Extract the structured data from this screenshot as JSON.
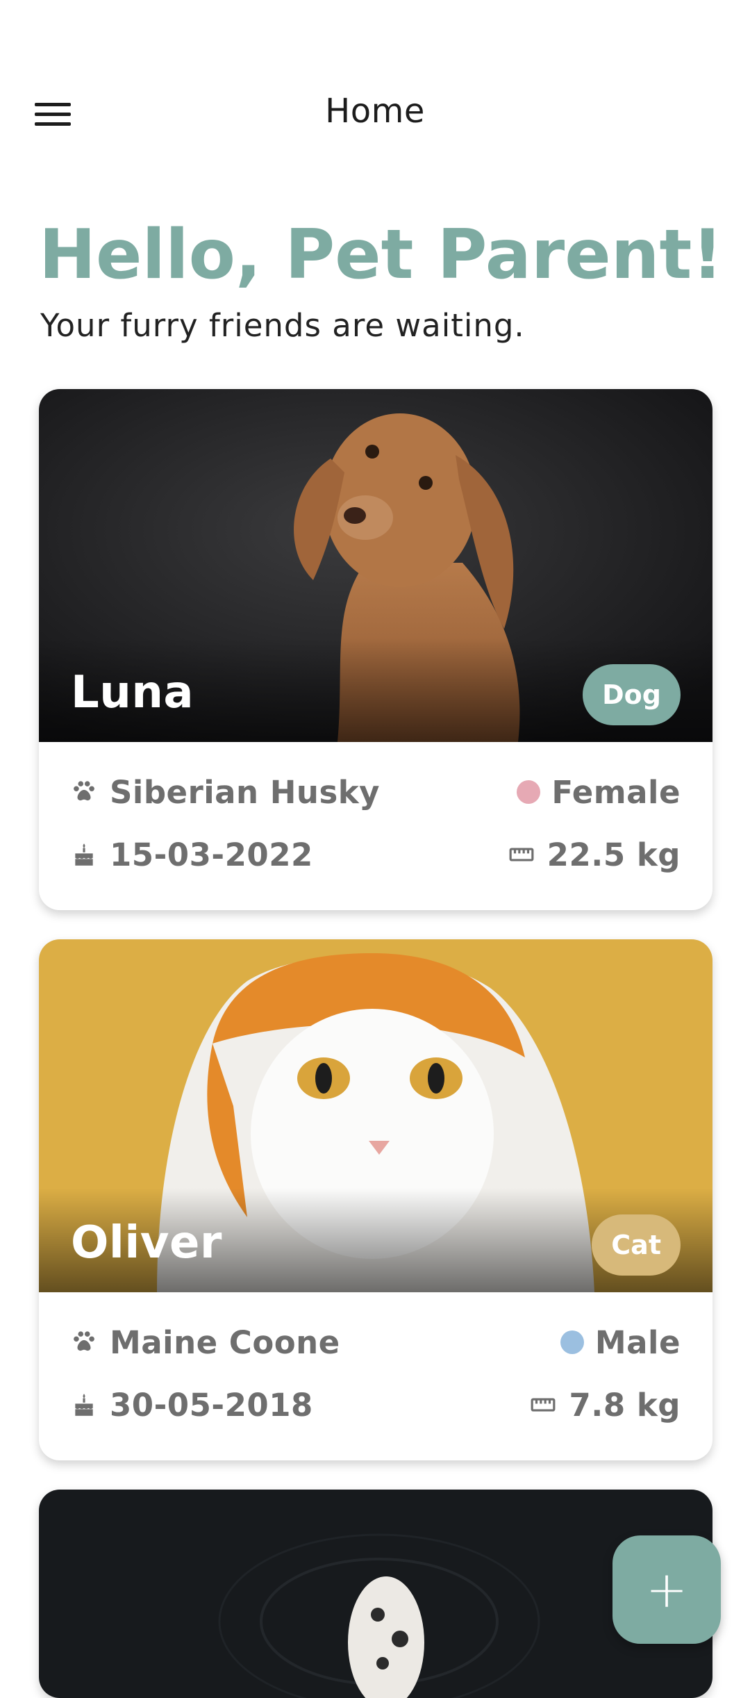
{
  "appbar": {
    "title": "Home",
    "menu_icon": "menu-icon"
  },
  "greeting": {
    "title": "Hello, Pet Parent!",
    "subtitle": "Your furry friends are waiting."
  },
  "colors": {
    "accent": "#7eaba2",
    "dog_badge": "#7eaba2",
    "cat_badge": "#d7b97a",
    "female_dot": "#e6a9b4",
    "male_dot": "#9bbfe0"
  },
  "pets": [
    {
      "name": "Luna",
      "type": "Dog",
      "breed": "Siberian Husky",
      "gender": "Female",
      "birthdate": "15-03-2022",
      "weight": "22.5 kg"
    },
    {
      "name": "Oliver",
      "type": "Cat",
      "breed": "Maine Coone",
      "gender": "Male",
      "birthdate": "30-05-2018",
      "weight": "7.8 kg"
    }
  ],
  "icons": {
    "breed": "paw-icon",
    "birthday": "cake-icon",
    "weight": "ruler-icon",
    "fab": "plus-icon"
  },
  "fab": {
    "label": "+"
  }
}
